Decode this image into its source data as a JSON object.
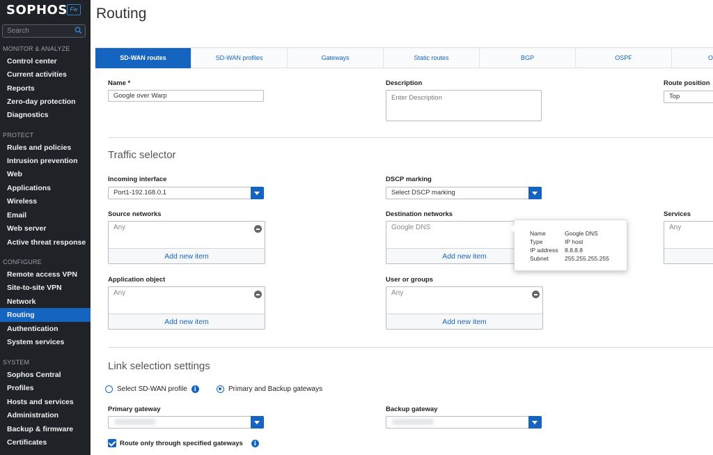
{
  "sidebar": {
    "brand": "SOPHOS",
    "badge": "Fw",
    "search_placeholder": "Search",
    "sections": {
      "monitor": "MONITOR & ANALYZE",
      "protect": "PROTECT",
      "configure": "CONFIGURE",
      "system": "SYSTEM"
    },
    "items": [
      "Control center",
      "Current activities",
      "Reports",
      "Zero-day protection",
      "Diagnostics",
      "Rules and policies",
      "Intrusion prevention",
      "Web",
      "Applications",
      "Wireless",
      "Email",
      "Web server",
      "Active threat response",
      "Remote access VPN",
      "Site-to-site VPN",
      "Network",
      "Routing",
      "Authentication",
      "System services",
      "Sophos Central",
      "Profiles",
      "Hosts and services",
      "Administration",
      "Backup & firmware",
      "Certificates"
    ],
    "active_item": "Routing"
  },
  "page": {
    "title": "Routing"
  },
  "tabs": [
    "SD-WAN routes",
    "SD-WAN profiles",
    "Gateways",
    "Static routes",
    "BGP",
    "OSPF",
    "O"
  ],
  "form": {
    "name_label": "Name *",
    "name_value": "Google over Warp",
    "description_label": "Description",
    "description_placeholder": "Enter Description",
    "route_position_label": "Route position",
    "route_position_value": "Top"
  },
  "traffic": {
    "heading": "Traffic selector",
    "incoming_label": "Incoming interface",
    "incoming_value": "Port1-192.168.0.1",
    "dscp_label": "DSCP marking",
    "dscp_value": "Select DSCP marking",
    "source_label": "Source networks",
    "source_item": "Any",
    "destination_label": "Destination networks",
    "destination_item": "Google DNS",
    "services_label": "Services",
    "services_item": "Any",
    "app_label": "Application object",
    "app_item": "Any",
    "users_label": "User or groups",
    "users_item": "Any",
    "add_new": "Add new item"
  },
  "tooltip": {
    "name_k": "Name",
    "name_v": "Google DNS",
    "type_k": "Type",
    "type_v": "IP host",
    "ip_k": "IP address",
    "ip_v": "8.8.8.8",
    "subnet_k": "Subnet",
    "subnet_v": "255.255.255.255"
  },
  "link": {
    "heading": "Link selection settings",
    "option_profile": "Select SD-WAN profile",
    "option_gateways": "Primary and Backup gateways",
    "selected_option": "Primary and Backup gateways",
    "primary_label": "Primary gateway",
    "backup_label": "Backup gateway",
    "checkbox_label": "Route only through specified gateways",
    "checkbox_checked": true
  },
  "colors": {
    "accent": "#1565c0",
    "sidebar_bg": "#1f2226"
  }
}
